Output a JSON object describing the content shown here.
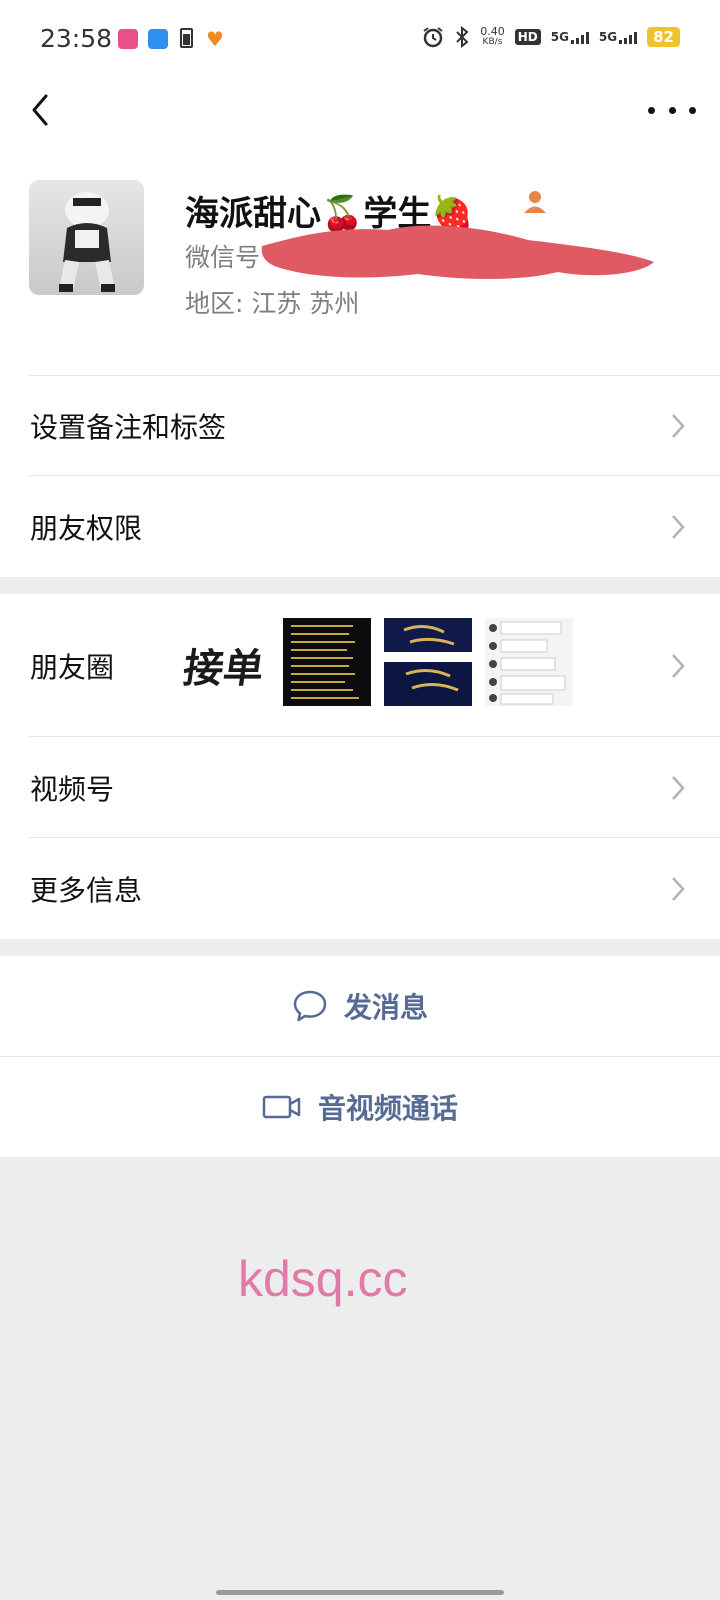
{
  "status_bar": {
    "time": "23:58",
    "net_speed_value": "0.40",
    "net_speed_unit": "KB/s",
    "hd_label": "HD",
    "signal1": "5G",
    "signal2": "5G",
    "battery": "82",
    "icons": [
      "app-icon-pink",
      "app-icon-blue",
      "battery-saver-icon",
      "heart-app-icon",
      "alarm-icon",
      "bluetooth-icon"
    ]
  },
  "nav": {
    "back_icon": "chevron-left-icon",
    "more_icon": "more-icon"
  },
  "profile": {
    "name": "海派甜心🍒学生🍓",
    "wechat_id_label": "微信号",
    "region": "地区:  江苏  苏州",
    "contact_icon": "person-icon"
  },
  "menu_group_1": [
    {
      "label": "设置备注和标签"
    },
    {
      "label": "朋友权限"
    }
  ],
  "menu_group_2": [
    {
      "label": "朋友圈"
    },
    {
      "label": "视频号"
    },
    {
      "label": "更多信息"
    }
  ],
  "moments_thumbs": {
    "thumb1_text": "接单"
  },
  "actions": {
    "message_label": "发消息",
    "call_label": "音视频通话"
  },
  "watermark": "kdsq.cc",
  "colors": {
    "link_blue": "#576b95",
    "background": "#ededed",
    "battery": "#f2c12e",
    "watermark": "#e07aa8"
  }
}
